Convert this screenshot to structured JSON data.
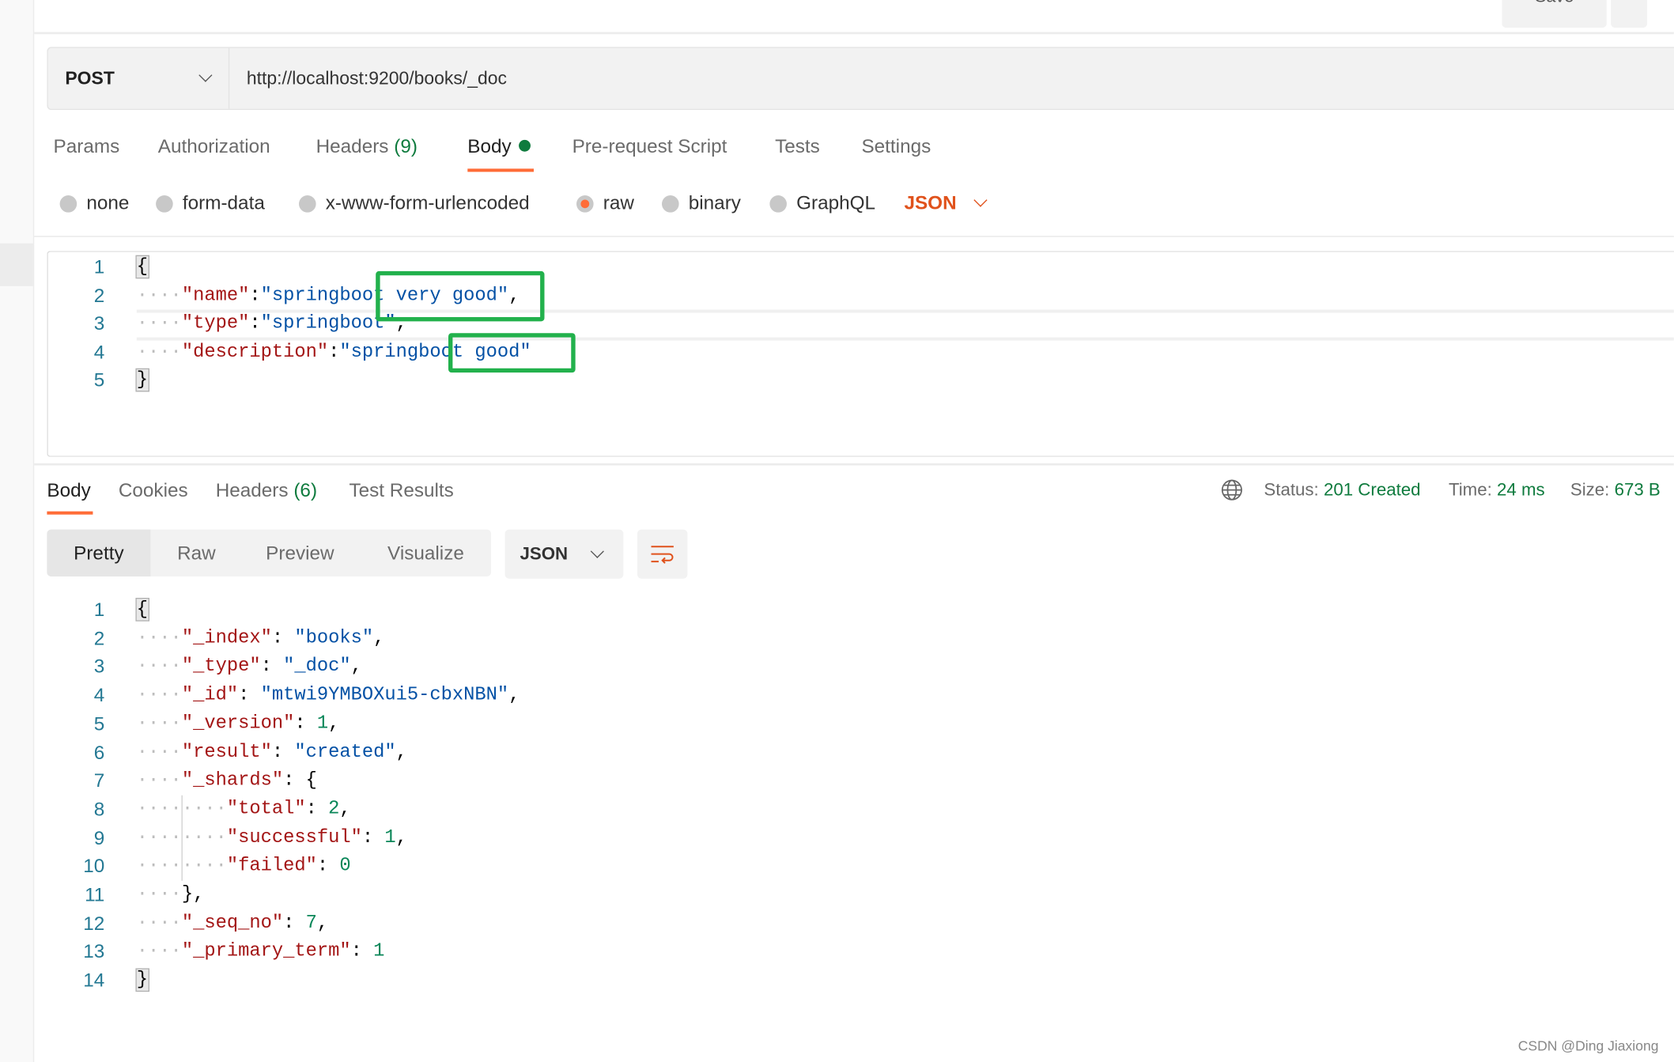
{
  "header": {
    "save_label": "Save"
  },
  "request": {
    "method": "POST",
    "url": "http://localhost:9200/books/_doc"
  },
  "request_tabs": [
    "Params",
    "Authorization",
    "Headers",
    "Body",
    "Pre-request Script",
    "Tests",
    "Settings"
  ],
  "request_headers_count": "(9)",
  "body_types": [
    "none",
    "form-data",
    "x-www-form-urlencoded",
    "raw",
    "binary",
    "GraphQL"
  ],
  "body_type_selected": "raw",
  "body_format": "JSON",
  "request_body": [
    [
      [
        "b",
        "{"
      ]
    ],
    [
      [
        "w",
        "····"
      ],
      [
        "k",
        "\"name\""
      ],
      [
        "p",
        ":"
      ],
      [
        "s",
        "\"springboot very good\""
      ],
      [
        "p",
        ","
      ]
    ],
    [
      [
        "w",
        "····"
      ],
      [
        "k",
        "\"type\""
      ],
      [
        "p",
        ":"
      ],
      [
        "s",
        "\"springboot\""
      ],
      [
        "p",
        ","
      ]
    ],
    [
      [
        "w",
        "····"
      ],
      [
        "k",
        "\"description\""
      ],
      [
        "p",
        ":"
      ],
      [
        "s",
        "\"springboot good\""
      ]
    ],
    [
      [
        "b",
        "}"
      ]
    ]
  ],
  "response_tabs": [
    "Body",
    "Cookies",
    "Headers",
    "Test Results"
  ],
  "response_headers_count": "(6)",
  "response_status": {
    "status_label": "Status:",
    "status": "201 Created",
    "time_label": "Time:",
    "time": "24 ms",
    "size_label": "Size:",
    "size": "673 B"
  },
  "view_modes": [
    "Pretty",
    "Raw",
    "Preview",
    "Visualize"
  ],
  "response_format": "JSON",
  "response_body": [
    [
      [
        "b",
        "{"
      ]
    ],
    [
      [
        "w",
        "····"
      ],
      [
        "k",
        "\"_index\""
      ],
      [
        "p",
        ": "
      ],
      [
        "s",
        "\"books\""
      ],
      [
        "p",
        ","
      ]
    ],
    [
      [
        "w",
        "····"
      ],
      [
        "k",
        "\"_type\""
      ],
      [
        "p",
        ": "
      ],
      [
        "s",
        "\"_doc\""
      ],
      [
        "p",
        ","
      ]
    ],
    [
      [
        "w",
        "····"
      ],
      [
        "k",
        "\"_id\""
      ],
      [
        "p",
        ": "
      ],
      [
        "s",
        "\"mtwi9YMBOXui5-cbxNBN\""
      ],
      [
        "p",
        ","
      ]
    ],
    [
      [
        "w",
        "····"
      ],
      [
        "k",
        "\"_version\""
      ],
      [
        "p",
        ": "
      ],
      [
        "n",
        "1"
      ],
      [
        "p",
        ","
      ]
    ],
    [
      [
        "w",
        "····"
      ],
      [
        "k",
        "\"result\""
      ],
      [
        "p",
        ": "
      ],
      [
        "s",
        "\"created\""
      ],
      [
        "p",
        ","
      ]
    ],
    [
      [
        "w",
        "····"
      ],
      [
        "k",
        "\"_shards\""
      ],
      [
        "p",
        ": {"
      ]
    ],
    [
      [
        "w",
        "········"
      ],
      [
        "k",
        "\"total\""
      ],
      [
        "p",
        ": "
      ],
      [
        "n",
        "2"
      ],
      [
        "p",
        ","
      ]
    ],
    [
      [
        "w",
        "········"
      ],
      [
        "k",
        "\"successful\""
      ],
      [
        "p",
        ": "
      ],
      [
        "n",
        "1"
      ],
      [
        "p",
        ","
      ]
    ],
    [
      [
        "w",
        "········"
      ],
      [
        "k",
        "\"failed\""
      ],
      [
        "p",
        ": "
      ],
      [
        "n",
        "0"
      ]
    ],
    [
      [
        "w",
        "····"
      ],
      [
        "p",
        "},"
      ]
    ],
    [
      [
        "w",
        "····"
      ],
      [
        "k",
        "\"_seq_no\""
      ],
      [
        "p",
        ": "
      ],
      [
        "n",
        "7"
      ],
      [
        "p",
        ","
      ]
    ],
    [
      [
        "w",
        "····"
      ],
      [
        "k",
        "\"_primary_term\""
      ],
      [
        "p",
        ": "
      ],
      [
        "n",
        "1"
      ]
    ],
    [
      [
        "b",
        "}"
      ]
    ]
  ],
  "watermark": "CSDN @Ding Jiaxiong",
  "colors": {
    "accent": "#ff6c37",
    "success": "#0f7b3e",
    "highlight_box": "#22b14c"
  }
}
